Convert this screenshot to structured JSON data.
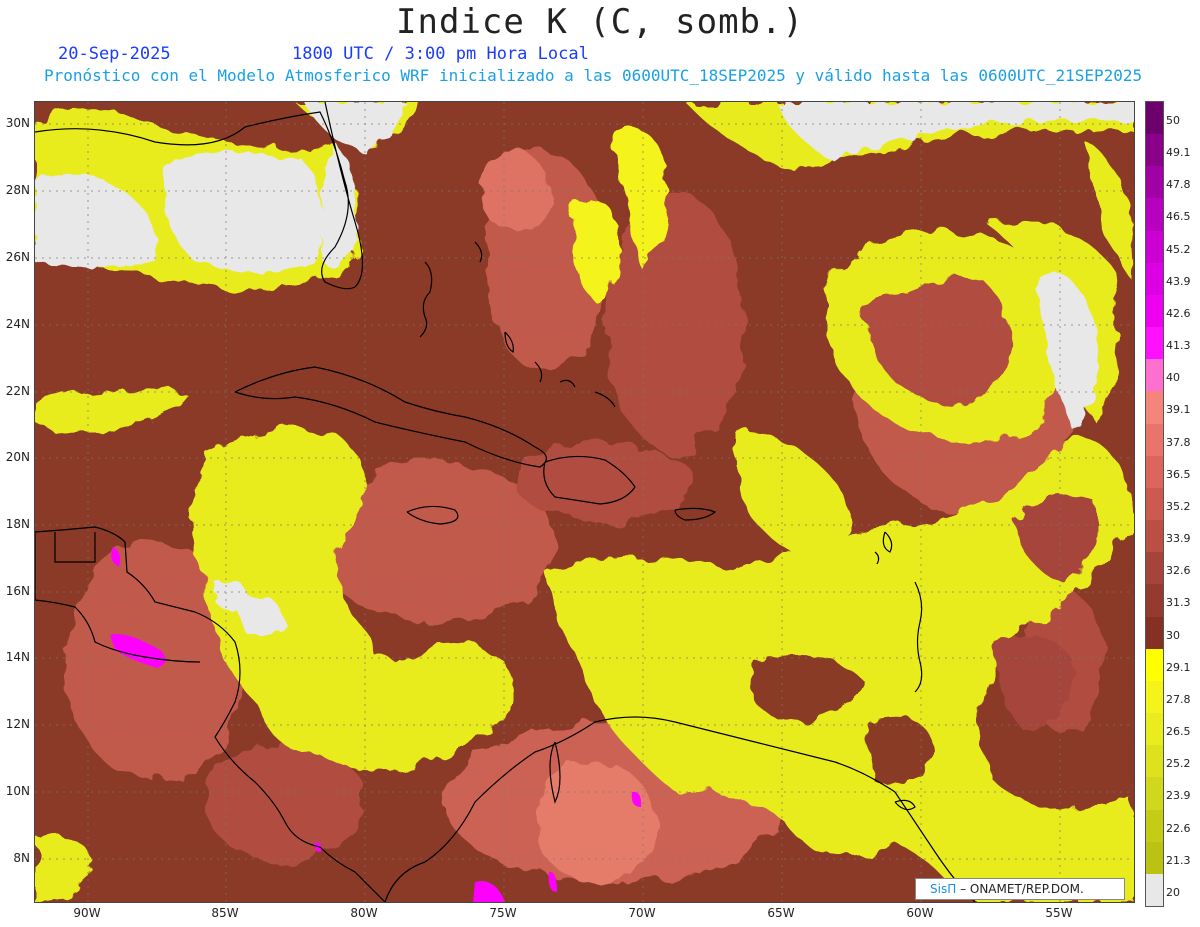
{
  "header": {
    "title": "Indice K (C, somb.)",
    "date": "20-Sep-2025",
    "time": "1800 UTC / 3:00 pm Hora Local",
    "subtitle": "Pronóstico con el Modelo Atmosferico WRF inicializado a las 0600UTC_18SEP2025 y válido hasta las  0600UTC_21SEP2025"
  },
  "lat_labels": [
    "30N",
    "28N",
    "26N",
    "24N",
    "22N",
    "20N",
    "18N",
    "16N",
    "14N",
    "12N",
    "10N",
    "8N"
  ],
  "lon_labels": [
    "90W",
    "85W",
    "80W",
    "75W",
    "70W",
    "65W",
    "60W",
    "55W"
  ],
  "colorbar": {
    "labels": [
      "50",
      "49.1",
      "47.8",
      "46.5",
      "45.2",
      "43.9",
      "42.6",
      "41.3",
      "40",
      "39.1",
      "37.8",
      "36.5",
      "35.2",
      "33.9",
      "32.6",
      "31.3",
      "30",
      "29.1",
      "27.8",
      "26.5",
      "25.2",
      "23.9",
      "22.6",
      "21.3",
      "20"
    ],
    "colors": [
      "#6e006e",
      "#8a008a",
      "#a000a6",
      "#b800c0",
      "#cc00d2",
      "#de00e4",
      "#ee00f0",
      "#ff10ff",
      "#ff6fcf",
      "#f4857a",
      "#e9756a",
      "#dc665c",
      "#cc5a4f",
      "#bb4f44",
      "#a5443a",
      "#943a2e",
      "#843024",
      "#ffff00",
      "#f4f41a",
      "#e9ec1e",
      "#dde21c",
      "#d1d71a",
      "#c5cc16",
      "#bac214",
      "#e8e8e8"
    ]
  },
  "credit": {
    "logo": "SisΠ",
    "text": "– ONAMET/REP.DOM."
  },
  "colors": {
    "land_missing": "#e8e8e8",
    "title_blue": "#1a3cff",
    "subtitle_cyan": "#1aa0e6"
  }
}
